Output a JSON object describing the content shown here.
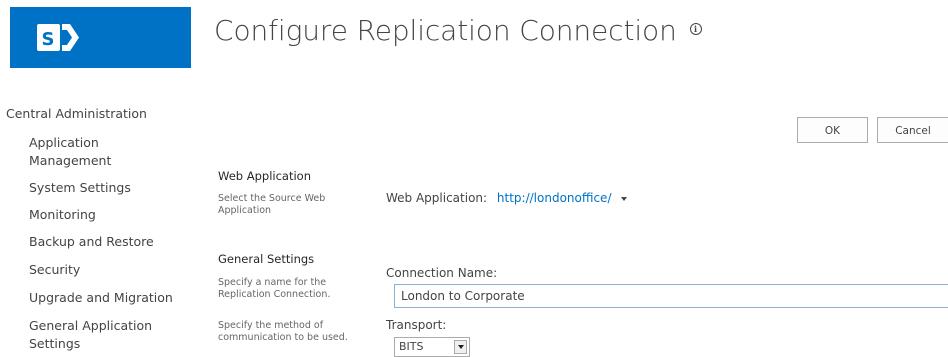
{
  "header": {
    "title": "Configure Replication Connection",
    "logo_letter": "S",
    "info_icon": "info-icon"
  },
  "nav": {
    "root": "Central Administration",
    "items": [
      {
        "label": "Application Management"
      },
      {
        "label": "System Settings"
      },
      {
        "label": "Monitoring"
      },
      {
        "label": "Backup and Restore"
      },
      {
        "label": "Security"
      },
      {
        "label": "Upgrade and Migration"
      },
      {
        "label": "General Application Settings"
      }
    ]
  },
  "buttons": {
    "ok": "OK",
    "cancel": "Cancel"
  },
  "sections": {
    "web_application": {
      "title": "Web Application",
      "description": "Select the Source Web Application",
      "field_label": "Web Application:",
      "value": "http://londonoffice/"
    },
    "general_settings": {
      "title": "General Settings",
      "description_name": "Specify a name for the Replication Connection.",
      "description_transport": "Specify the method of communication to be used.",
      "connection_name_label": "Connection Name:",
      "connection_name_value": "London to Corporate",
      "transport_label": "Transport:",
      "transport_value": "BITS"
    }
  },
  "colors": {
    "brand": "#0072c6",
    "link": "#0072c6",
    "text": "#444444"
  }
}
